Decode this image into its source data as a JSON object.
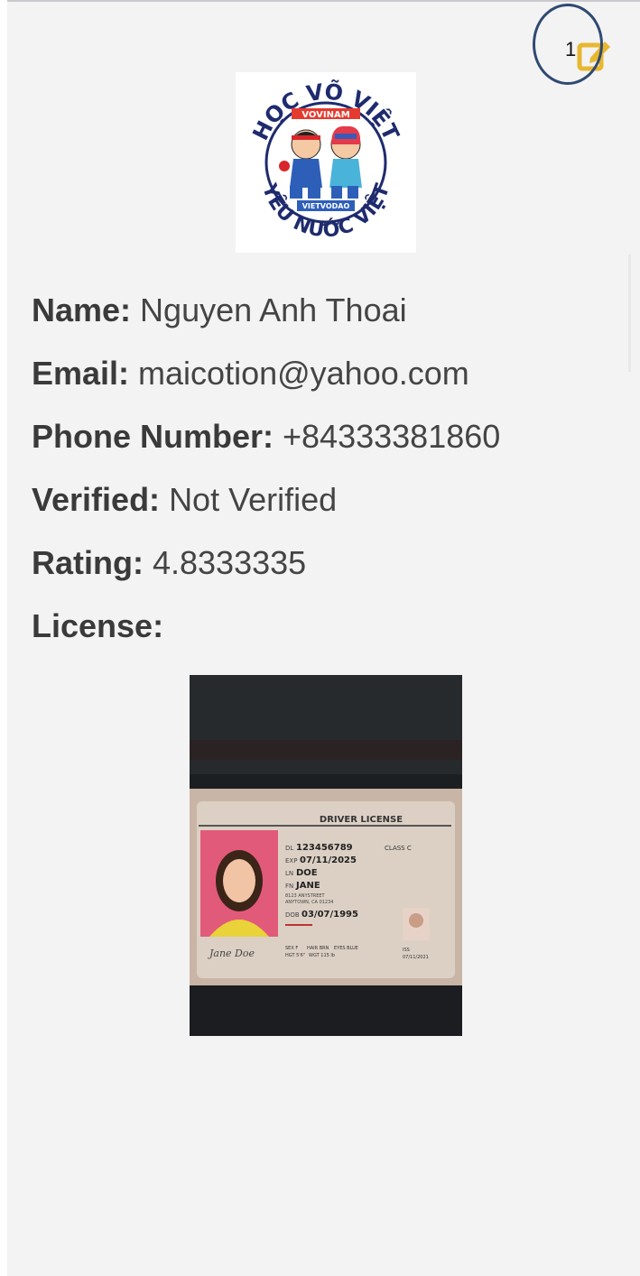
{
  "profile": {
    "logo": {
      "top_text": "HỌC VÕ VIỆT",
      "bottom_text": "YÊU NƯỚC VIỆT",
      "banner_top": "VOVINAM",
      "banner_bottom": "VIETVODAO"
    },
    "fields": [
      {
        "label": "Name:",
        "value": "Nguyen Anh Thoai"
      },
      {
        "label": "Email:",
        "value": "maicotion@yahoo.com"
      },
      {
        "label": "Phone Number:",
        "value": "+84333381860"
      },
      {
        "label": "Verified:",
        "value": "Not Verified"
      },
      {
        "label": "Rating:",
        "value": "4.8333335"
      },
      {
        "label": "License:",
        "value": ""
      }
    ],
    "edit_icon": "edit-icon",
    "annotation_number": "1"
  },
  "license_card": {
    "title": "DRIVER LICENSE",
    "dl_label": "DL",
    "dl_number": "123456789",
    "class": "CLASS C",
    "exp_label": "EXP",
    "exp_date": "07/11/2025",
    "ln_label": "LN",
    "last_name": "DOE",
    "fn_label": "FN",
    "first_name": "JANE",
    "address_line1": "8123 ANYSTREET",
    "address_line2": "ANYTOWN, CA 01234",
    "dob_label": "DOB",
    "dob": "03/07/1995",
    "signature": "Jane Doe",
    "sex": "SEX F",
    "hair": "HAIR BRN",
    "eyes": "EYES BLUE",
    "hgt": "HGT 5'6\"",
    "wgt": "WGT 115 lb",
    "iss": "ISS",
    "iss_date": "07/11/2021"
  },
  "colors": {
    "background": "#f3f3f3",
    "label": "#3a3a3a",
    "edit_icon": "#e8b730",
    "annotation": "#2f4a72"
  }
}
